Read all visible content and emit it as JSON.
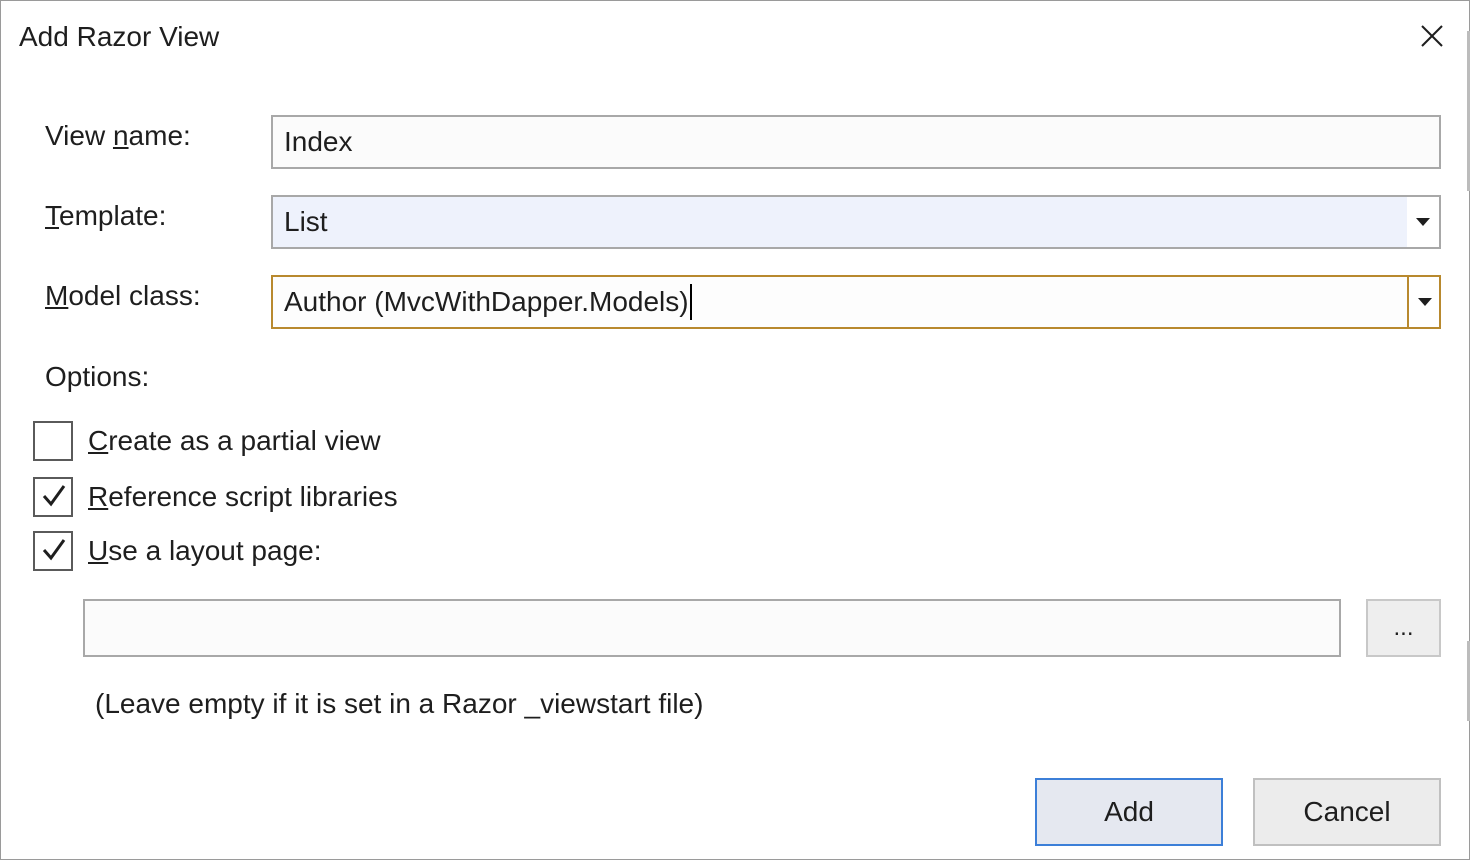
{
  "dialog": {
    "title": "Add Razor View",
    "close_icon": "close-icon"
  },
  "form": {
    "view_name": {
      "label_prefix": "View ",
      "label_access": "n",
      "label_suffix": "ame:",
      "value": "Index"
    },
    "template": {
      "label_access": "T",
      "label_suffix": "emplate:",
      "value": "List"
    },
    "model_class": {
      "label_access": "M",
      "label_suffix": "odel class:",
      "value": "Author (MvcWithDapper.Models)"
    }
  },
  "options": {
    "label": "Options:",
    "items": [
      {
        "access": "C",
        "rest": "reate as a partial view",
        "checked": false
      },
      {
        "access": "R",
        "rest": "eference script libraries",
        "checked": true
      },
      {
        "access": "U",
        "rest": "se a layout page:",
        "checked": true
      }
    ],
    "layout_path": "",
    "browse_label": "...",
    "hint": "(Leave empty if it is set in a Razor _viewstart file)"
  },
  "buttons": {
    "add": "Add",
    "cancel": "Cancel"
  },
  "colors": {
    "focus_border": "#b8892e",
    "default_button_border": "#3c7fd8"
  }
}
